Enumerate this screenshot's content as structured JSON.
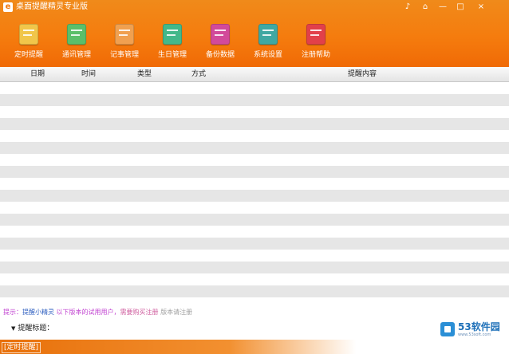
{
  "window": {
    "title": "桌面提醒精灵专业版",
    "controls": [
      "♪",
      "⌂",
      "—",
      "□",
      "×"
    ]
  },
  "toolbar": {
    "items": [
      {
        "label": "定时提醒",
        "icon": "calendar-icon",
        "color": "#f1c64a"
      },
      {
        "label": "通讯管理",
        "icon": "contacts-icon",
        "color": "#5bbf6a"
      },
      {
        "label": "记事管理",
        "icon": "notepad-icon",
        "color": "#f0a050"
      },
      {
        "label": "生日管理",
        "icon": "birthday-icon",
        "color": "#43b88a"
      },
      {
        "label": "备份数据",
        "icon": "backup-icon",
        "color": "#d24a9a"
      },
      {
        "label": "系统设置",
        "icon": "settings-icon",
        "color": "#3fa8a2"
      },
      {
        "label": "注册帮助",
        "icon": "help-icon",
        "color": "#e2404a"
      }
    ]
  },
  "table": {
    "columns": [
      "日期",
      "时间",
      "类型",
      "方式",
      "提醒内容"
    ],
    "row_count": 18
  },
  "hint": {
    "prefix": "提示：",
    "part1": "提醒小精灵 ",
    "part2": "以下版本的试用用户，",
    "part3": "需要购买注册",
    "part4": " 版本请注册"
  },
  "remind": {
    "arrow": "▼",
    "label": "提醒标题："
  },
  "status": {
    "text": "[定时提醒]"
  },
  "watermark": {
    "brand": "53软件园",
    "sub": "www.53soft.com"
  }
}
